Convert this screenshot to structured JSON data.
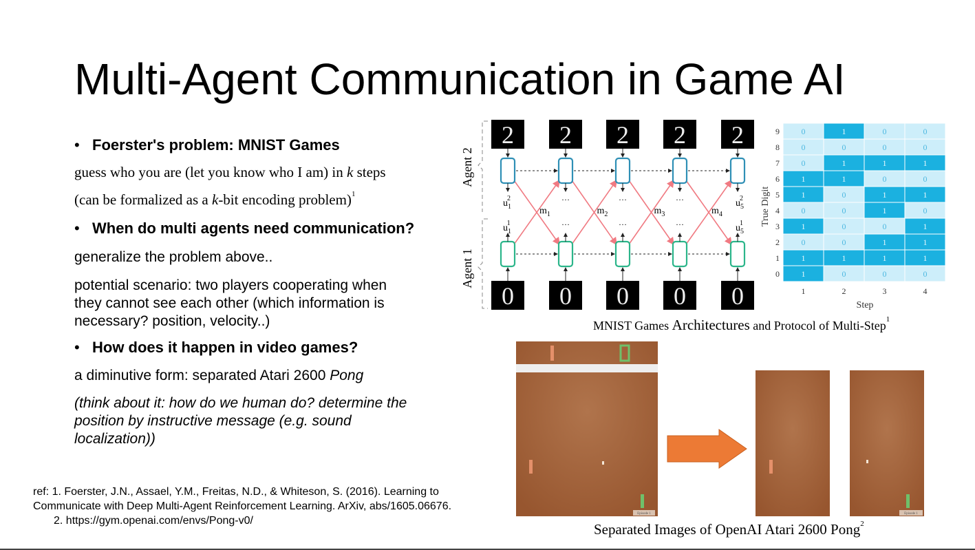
{
  "title": "Multi-Agent Communication in Game AI",
  "bullets": {
    "b1": "Foerster's problem: MNIST Games",
    "b2": "When do multi agents need communication?",
    "b3": "How does it happen in video games?",
    "bullet_symbol": "•"
  },
  "text": {
    "guess_pre": "guess who you are (let you know who I am) in ",
    "guess_k": "k",
    "guess_post": " steps",
    "formal_pre": "(can be formalized as a ",
    "formal_k": "k",
    "formal_post": "-bit encoding problem)",
    "formal_sup": "1",
    "generalize": "generalize the problem above..",
    "scenario_1": "potential scenario: two players cooperating when",
    "scenario_2": "they cannot see each other (which information is",
    "scenario_3": "necessary? position, velocity..)",
    "diminutive_pre": "a diminutive form: separated Atari 2600 ",
    "diminutive_pong": "Pong",
    "think_1": "(think about it: how do we human do? determine the",
    "think_2": "position by instructive message (e.g. sound",
    "think_3": "localization))"
  },
  "refs": {
    "line1": "ref: 1. Foerster, J.N., Assael, Y.M., Freitas, N.D., & Whiteson, S. (2016). Learning to",
    "line2": "Communicate with Deep Multi-Agent Reinforcement Learning. ArXiv, abs/1605.06676.",
    "line3": "2. https://gym.openai.com/envs/Pong-v0/"
  },
  "captions": {
    "mnist_pre": "MNIST Games ",
    "mnist_mid": "Architectures",
    "mnist_post": " and Protocol of Multi-Step",
    "mnist_sup": "1",
    "pong": "Separated Images of OpenAI Atari 2600 Pong",
    "pong_sup": "2"
  },
  "diagram": {
    "agent2": "Agent 2",
    "agent1": "Agent 1",
    "digit_top": "2",
    "digit_bottom": "0",
    "u_left_top": "u",
    "u_left_top_sub": "1",
    "u_left_top_sup": "2",
    "u_left_bot_sub": "1",
    "u_left_bot_sup": "1",
    "u_right_top_sub": "5",
    "u_right_top_sup": "2",
    "u_right_bot_sub": "5",
    "u_right_bot_sup": "1",
    "ellipsis": "···",
    "messages": [
      "m1",
      "m2",
      "m3",
      "m4"
    ],
    "message_letter": "m",
    "message_subs": [
      "1",
      "2",
      "3",
      "4"
    ]
  },
  "heatmap": {
    "ylabel": "True Digit",
    "xlabel": "Step",
    "x_ticks": [
      "1",
      "2",
      "3",
      "4"
    ],
    "y_ticks": [
      "9",
      "8",
      "7",
      "6",
      "5",
      "4",
      "3",
      "2",
      "1",
      "0"
    ],
    "rows": [
      [
        0,
        1,
        0,
        0
      ],
      [
        0,
        0,
        0,
        0
      ],
      [
        0,
        1,
        1,
        1
      ],
      [
        1,
        1,
        0,
        0
      ],
      [
        1,
        0,
        1,
        1
      ],
      [
        0,
        0,
        1,
        0
      ],
      [
        1,
        0,
        0,
        1
      ],
      [
        0,
        0,
        1,
        1
      ],
      [
        1,
        1,
        1,
        1
      ],
      [
        1,
        0,
        0,
        0
      ]
    ],
    "color_on": "#1bb1e0",
    "color_off": "#cdeefa"
  },
  "pong": {
    "episode_label": "Episode 1",
    "bg_color": "#a0603a",
    "arrow_color": "#ec7a35",
    "paddle_left_color": "#e5906a",
    "paddle_right_color": "#6fc06a"
  }
}
